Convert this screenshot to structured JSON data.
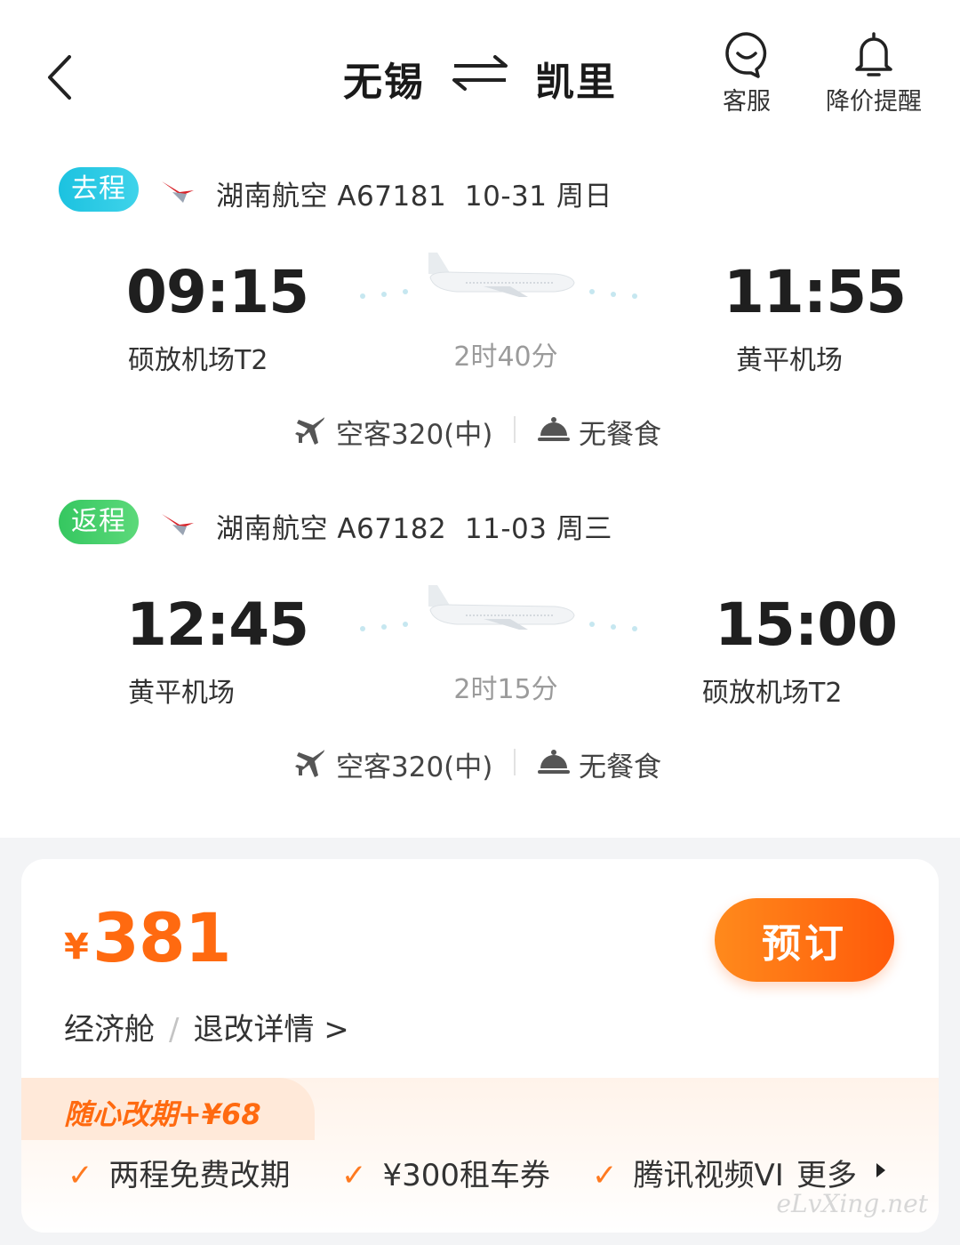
{
  "header": {
    "from_city": "无锡",
    "to_city": "凯里",
    "service_label": "客服",
    "alert_label": "降价提醒"
  },
  "outbound": {
    "tag": "去程",
    "airline_flight": "湖南航空 A67181",
    "date": "10-31 周日",
    "dep_time": "09:15",
    "dep_airport": "硕放机场T2",
    "duration": "2时40分",
    "arr_time": "11:55",
    "arr_airport": "黄平机场",
    "aircraft": "空客320(中)",
    "meal": "无餐食"
  },
  "return": {
    "tag": "返程",
    "airline_flight": "湖南航空 A67182",
    "date": "11-03 周三",
    "dep_time": "12:45",
    "dep_airport": "黄平机场",
    "duration": "2时15分",
    "arr_time": "15:00",
    "arr_airport": "硕放机场T2",
    "aircraft": "空客320(中)",
    "meal": "无餐食"
  },
  "offer": {
    "currency": "¥",
    "price": "381",
    "book_label": "预订",
    "cabin": "经济舱",
    "refund_label": "退改详情 >",
    "benefit_title": "随心改期+¥68",
    "benefits": [
      "两程免费改期",
      "¥300租车券",
      "腾讯视频VI"
    ],
    "more_label": "更多"
  },
  "watermark": "eLvXing.net",
  "colors": {
    "accent": "#ff6a10",
    "tag_go": "#1cc2e0",
    "tag_return": "#35c760"
  },
  "icons": [
    "back-icon",
    "swap-icon",
    "service-icon",
    "bell-icon",
    "airline-logo-icon",
    "plane-icon",
    "aircraft-icon",
    "meal-icon",
    "check-icon",
    "triangle-right-icon"
  ]
}
